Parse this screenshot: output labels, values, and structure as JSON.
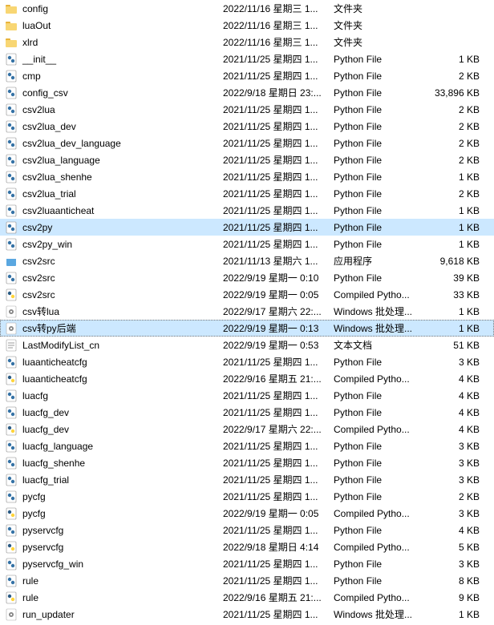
{
  "files": [
    {
      "icon": "folder",
      "name": "config",
      "date": "2022/11/16 星期三 1...",
      "type": "文件夹",
      "size": ""
    },
    {
      "icon": "folder",
      "name": "luaOut",
      "date": "2022/11/16 星期三 1...",
      "type": "文件夹",
      "size": ""
    },
    {
      "icon": "folder",
      "name": "xlrd",
      "date": "2022/11/16 星期三 1...",
      "type": "文件夹",
      "size": ""
    },
    {
      "icon": "py",
      "name": "__init__",
      "date": "2021/11/25 星期四 1...",
      "type": "Python File",
      "size": "1 KB"
    },
    {
      "icon": "py",
      "name": "cmp",
      "date": "2021/11/25 星期四 1...",
      "type": "Python File",
      "size": "2 KB"
    },
    {
      "icon": "py",
      "name": "config_csv",
      "date": "2022/9/18 星期日 23:...",
      "type": "Python File",
      "size": "33,896 KB"
    },
    {
      "icon": "py",
      "name": "csv2lua",
      "date": "2021/11/25 星期四 1...",
      "type": "Python File",
      "size": "2 KB"
    },
    {
      "icon": "py",
      "name": "csv2lua_dev",
      "date": "2021/11/25 星期四 1...",
      "type": "Python File",
      "size": "2 KB"
    },
    {
      "icon": "py",
      "name": "csv2lua_dev_language",
      "date": "2021/11/25 星期四 1...",
      "type": "Python File",
      "size": "2 KB"
    },
    {
      "icon": "py",
      "name": "csv2lua_language",
      "date": "2021/11/25 星期四 1...",
      "type": "Python File",
      "size": "2 KB"
    },
    {
      "icon": "py",
      "name": "csv2lua_shenhe",
      "date": "2021/11/25 星期四 1...",
      "type": "Python File",
      "size": "1 KB"
    },
    {
      "icon": "py",
      "name": "csv2lua_trial",
      "date": "2021/11/25 星期四 1...",
      "type": "Python File",
      "size": "2 KB"
    },
    {
      "icon": "py",
      "name": "csv2luaanticheat",
      "date": "2021/11/25 星期四 1...",
      "type": "Python File",
      "size": "1 KB"
    },
    {
      "icon": "py",
      "name": "csv2py",
      "date": "2021/11/25 星期四 1...",
      "type": "Python File",
      "size": "1 KB",
      "selected": true
    },
    {
      "icon": "py",
      "name": "csv2py_win",
      "date": "2021/11/25 星期四 1...",
      "type": "Python File",
      "size": "1 KB"
    },
    {
      "icon": "exe",
      "name": "csv2src",
      "date": "2021/11/13 星期六 1...",
      "type": "应用程序",
      "size": "9,618 KB"
    },
    {
      "icon": "py",
      "name": "csv2src",
      "date": "2022/9/19 星期一 0:10",
      "type": "Python File",
      "size": "39 KB"
    },
    {
      "icon": "pyc",
      "name": "csv2src",
      "date": "2022/9/19 星期一 0:05",
      "type": "Compiled Pytho...",
      "size": "33 KB"
    },
    {
      "icon": "bat",
      "name": "csv转lua",
      "date": "2022/9/17 星期六 22:...",
      "type": "Windows 批处理...",
      "size": "1 KB"
    },
    {
      "icon": "bat",
      "name": "csv转py后端",
      "date": "2022/9/19 星期一 0:13",
      "type": "Windows 批处理...",
      "size": "1 KB",
      "focused": true
    },
    {
      "icon": "txt",
      "name": "LastModifyList_cn",
      "date": "2022/9/19 星期一 0:53",
      "type": "文本文档",
      "size": "51 KB"
    },
    {
      "icon": "py",
      "name": "luaanticheatcfg",
      "date": "2021/11/25 星期四 1...",
      "type": "Python File",
      "size": "3 KB"
    },
    {
      "icon": "pyc",
      "name": "luaanticheatcfg",
      "date": "2022/9/16 星期五 21:...",
      "type": "Compiled Pytho...",
      "size": "4 KB"
    },
    {
      "icon": "py",
      "name": "luacfg",
      "date": "2021/11/25 星期四 1...",
      "type": "Python File",
      "size": "4 KB"
    },
    {
      "icon": "py",
      "name": "luacfg_dev",
      "date": "2021/11/25 星期四 1...",
      "type": "Python File",
      "size": "4 KB"
    },
    {
      "icon": "pyc",
      "name": "luacfg_dev",
      "date": "2022/9/17 星期六 22:...",
      "type": "Compiled Pytho...",
      "size": "4 KB"
    },
    {
      "icon": "py",
      "name": "luacfg_language",
      "date": "2021/11/25 星期四 1...",
      "type": "Python File",
      "size": "3 KB"
    },
    {
      "icon": "py",
      "name": "luacfg_shenhe",
      "date": "2021/11/25 星期四 1...",
      "type": "Python File",
      "size": "3 KB"
    },
    {
      "icon": "py",
      "name": "luacfg_trial",
      "date": "2021/11/25 星期四 1...",
      "type": "Python File",
      "size": "3 KB"
    },
    {
      "icon": "py",
      "name": "pycfg",
      "date": "2021/11/25 星期四 1...",
      "type": "Python File",
      "size": "2 KB"
    },
    {
      "icon": "pyc",
      "name": "pycfg",
      "date": "2022/9/19 星期一 0:05",
      "type": "Compiled Pytho...",
      "size": "3 KB"
    },
    {
      "icon": "py",
      "name": "pyservcfg",
      "date": "2021/11/25 星期四 1...",
      "type": "Python File",
      "size": "4 KB"
    },
    {
      "icon": "pyc",
      "name": "pyservcfg",
      "date": "2022/9/18 星期日 4:14",
      "type": "Compiled Pytho...",
      "size": "5 KB"
    },
    {
      "icon": "py",
      "name": "pyservcfg_win",
      "date": "2021/11/25 星期四 1...",
      "type": "Python File",
      "size": "3 KB"
    },
    {
      "icon": "py",
      "name": "rule",
      "date": "2021/11/25 星期四 1...",
      "type": "Python File",
      "size": "8 KB"
    },
    {
      "icon": "pyc",
      "name": "rule",
      "date": "2022/9/16 星期五 21:...",
      "type": "Compiled Pytho...",
      "size": "9 KB"
    },
    {
      "icon": "bat",
      "name": "run_updater",
      "date": "2021/11/25 星期四 1...",
      "type": "Windows 批处理...",
      "size": "1 KB"
    }
  ]
}
